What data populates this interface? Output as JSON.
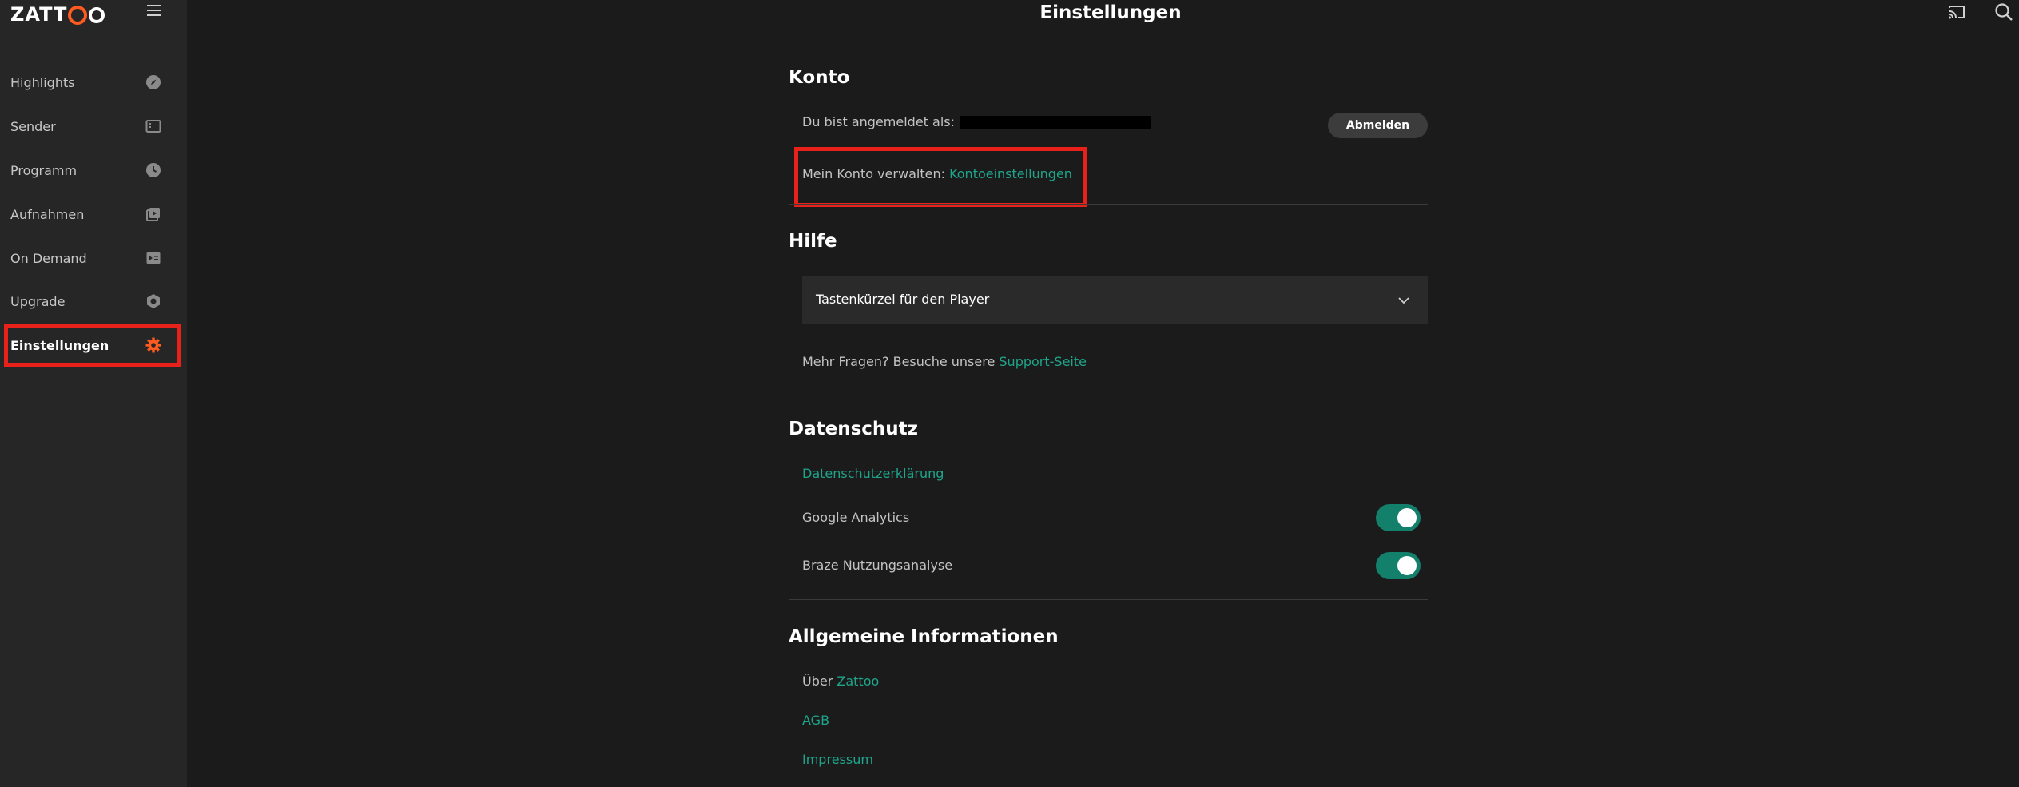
{
  "app": {
    "logo_text_left": "ZATT",
    "logo_text_right": "",
    "page_title": "Einstellungen"
  },
  "sidebar": {
    "items": [
      {
        "label": "Highlights",
        "icon": "compass-icon"
      },
      {
        "label": "Sender",
        "icon": "channels-icon"
      },
      {
        "label": "Programm",
        "icon": "clock-icon"
      },
      {
        "label": "Aufnahmen",
        "icon": "recordings-icon"
      },
      {
        "label": "On Demand",
        "icon": "on-demand-icon"
      },
      {
        "label": "Upgrade",
        "icon": "upgrade-icon"
      },
      {
        "label": "Einstellungen",
        "icon": "gear-icon",
        "active": true
      }
    ]
  },
  "konto": {
    "title": "Konto",
    "logged_in_label": "Du bist angemeldet als:",
    "logout_label": "Abmelden",
    "manage_label": "Mein Konto verwalten:",
    "manage_link": "Kontoeinstellungen"
  },
  "hilfe": {
    "title": "Hilfe",
    "accordion_label": "Tastenkürzel für den Player",
    "support_text": "Mehr Fragen? Besuche unsere",
    "support_link": "Support-Seite"
  },
  "datenschutz": {
    "title": "Datenschutz",
    "policy_link": "Datenschutzerklärung",
    "toggles": [
      {
        "label": "Google Analytics",
        "on": true
      },
      {
        "label": "Braze Nutzungsanalyse",
        "on": true
      }
    ]
  },
  "info": {
    "title": "Allgemeine Informationen",
    "about_prefix": "Über",
    "about_link": "Zattoo",
    "agb_link": "AGB",
    "impressum_link": "Impressum"
  },
  "colors": {
    "accent_orange": "#ff5a1f",
    "link_teal": "#1ea58b",
    "toggle_on": "#12806a",
    "highlight_red": "#e8221b"
  }
}
